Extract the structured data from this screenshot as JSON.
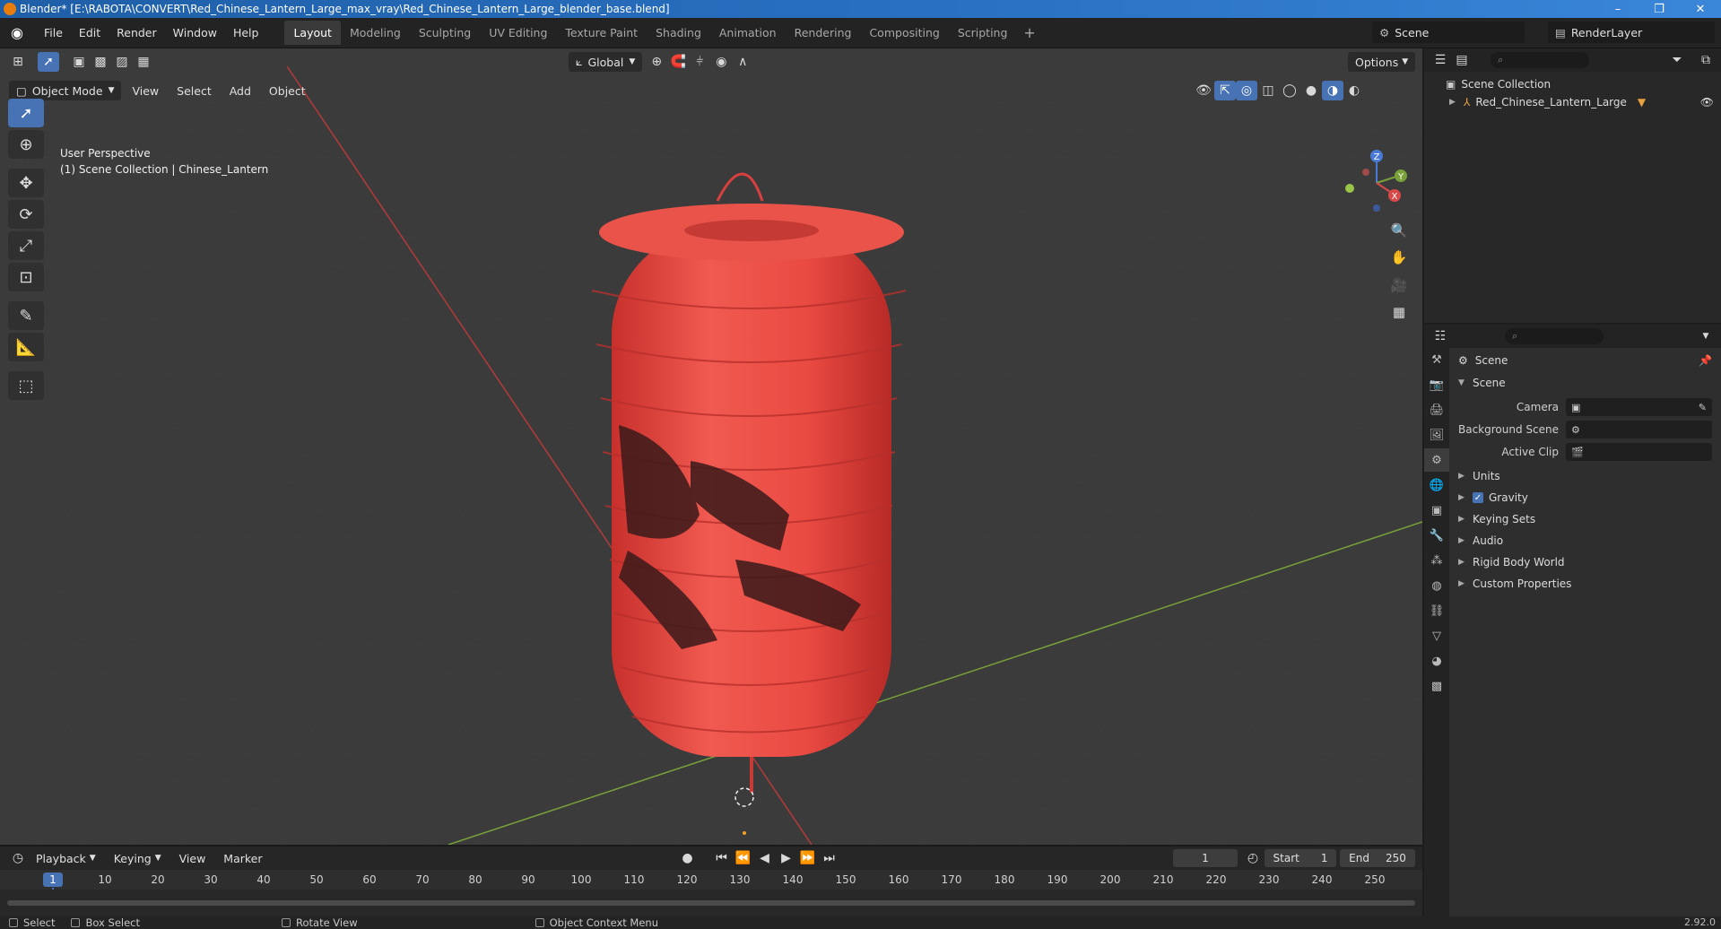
{
  "window": {
    "title": "Blender* [E:\\RABOTA\\CONVERT\\Red_Chinese_Lantern_Large_max_vray\\Red_Chinese_Lantern_Large_blender_base.blend]",
    "min": "–",
    "max": "❐",
    "close": "✕"
  },
  "menu": [
    "File",
    "Edit",
    "Render",
    "Window",
    "Help"
  ],
  "workspaces": [
    "Layout",
    "Modeling",
    "Sculpting",
    "UV Editing",
    "Texture Paint",
    "Shading",
    "Animation",
    "Rendering",
    "Compositing",
    "Scripting"
  ],
  "workspace_add": "+",
  "scene_name": "Scene",
  "render_layer": "RenderLayer",
  "viewport": {
    "orientation": "Global",
    "options": "Options",
    "mode": "Object Mode",
    "menus": [
      "View",
      "Select",
      "Add",
      "Object"
    ],
    "perspective": "User Perspective",
    "collection_info": "(1) Scene Collection | Chinese_Lantern",
    "axes": {
      "x": "X",
      "y": "Y",
      "z": "Z"
    }
  },
  "timeline": {
    "menus": [
      "Playback",
      "Keying",
      "View",
      "Marker"
    ],
    "current_frame": "1",
    "start_label": "Start",
    "start": "1",
    "end_label": "End",
    "end": "250",
    "ticks": [
      "10",
      "20",
      "30",
      "40",
      "50",
      "60",
      "70",
      "80",
      "90",
      "100",
      "110",
      "120",
      "130",
      "140",
      "150",
      "160",
      "170",
      "180",
      "190",
      "200",
      "210",
      "220",
      "230",
      "240",
      "250"
    ]
  },
  "statusbar": {
    "select": "Select",
    "box_select": "Box Select",
    "rotate_view": "Rotate View",
    "context_menu": "Object Context Menu",
    "version": "2.92.0"
  },
  "outliner": {
    "root": "Scene Collection",
    "items": [
      {
        "name": "Red_Chinese_Lantern_Large"
      }
    ]
  },
  "properties": {
    "context": "Scene",
    "panel": "Scene",
    "fields": [
      {
        "label": "Camera",
        "value": ""
      },
      {
        "label": "Background Scene",
        "value": ""
      },
      {
        "label": "Active Clip",
        "value": ""
      }
    ],
    "sections": [
      "Units",
      "Gravity",
      "Keying Sets",
      "Audio",
      "Rigid Body World",
      "Custom Properties"
    ]
  },
  "colors": {
    "accent": "#4772b3",
    "lantern": "#e8403a",
    "x_axis": "#b53a3a",
    "y_axis": "#7aa03a"
  }
}
